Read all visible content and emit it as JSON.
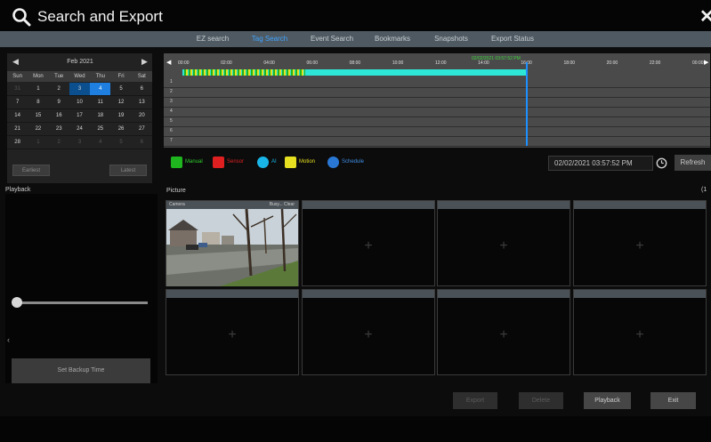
{
  "window": {
    "title": "Search and Export"
  },
  "tabs": [
    {
      "label": "EZ search"
    },
    {
      "label": "Tag Search",
      "active": true
    },
    {
      "label": "Event Search"
    },
    {
      "label": "Bookmarks"
    },
    {
      "label": "Snapshots"
    },
    {
      "label": "Export Status"
    }
  ],
  "calendar": {
    "month_label": "Feb  2021",
    "weekdays": [
      "Sun",
      "Mon",
      "Tue",
      "Wed",
      "Thu",
      "Fri",
      "Sat"
    ],
    "days": [
      {
        "d": "31",
        "muted": true
      },
      {
        "d": "1"
      },
      {
        "d": "2"
      },
      {
        "d": "3",
        "rec": true
      },
      {
        "d": "4",
        "sel": true
      },
      {
        "d": "5"
      },
      {
        "d": "6"
      },
      {
        "d": "7"
      },
      {
        "d": "8"
      },
      {
        "d": "9"
      },
      {
        "d": "10"
      },
      {
        "d": "11"
      },
      {
        "d": "12"
      },
      {
        "d": "13"
      },
      {
        "d": "14"
      },
      {
        "d": "15"
      },
      {
        "d": "16"
      },
      {
        "d": "17"
      },
      {
        "d": "18"
      },
      {
        "d": "19"
      },
      {
        "d": "20"
      },
      {
        "d": "21"
      },
      {
        "d": "22"
      },
      {
        "d": "23"
      },
      {
        "d": "24"
      },
      {
        "d": "25"
      },
      {
        "d": "26"
      },
      {
        "d": "27"
      },
      {
        "d": "28"
      },
      {
        "d": "1",
        "muted": true
      },
      {
        "d": "2",
        "muted": true
      },
      {
        "d": "3",
        "muted": true
      },
      {
        "d": "4",
        "muted": true
      },
      {
        "d": "5",
        "muted": true
      },
      {
        "d": "6",
        "muted": true
      }
    ],
    "earliest_label": "Earliest",
    "latest_label": "Latest"
  },
  "playback": {
    "label": "Playback",
    "backup_button": "Set Backup Time",
    "slider_value": 0
  },
  "timeline": {
    "ticks": [
      "00:00",
      "02:00",
      "04:00",
      "06:00",
      "08:00",
      "10:00",
      "12:00",
      "14:00",
      "16:00",
      "18:00",
      "20:00",
      "22:00",
      "00:00"
    ],
    "rows": [
      "1",
      "2",
      "3",
      "4",
      "5",
      "6",
      "7"
    ],
    "cursor_label": "02/02/2021 03:57:52 PM"
  },
  "legend": [
    {
      "label": "Manual",
      "color": "#1fb51f",
      "label_color": "#2fd02f"
    },
    {
      "label": "Sensor",
      "color": "#e02020",
      "label_color": "#e02020"
    },
    {
      "label": "AI",
      "color": "#19b6ea",
      "label_color": "#19b6ea"
    },
    {
      "label": "Motion",
      "color": "#e6e020",
      "label_color": "#e6e020"
    },
    {
      "label": "Schedule",
      "color": "#2a78d6",
      "label_color": "#3f8fe6"
    }
  ],
  "datetime": "02/02/2021 03:57:52 PM",
  "refresh_label": "Refresh",
  "pictures": {
    "label": "Picture",
    "count": "(1",
    "tile1_channel": "Camera",
    "tile1_status": "Busy... Clear"
  },
  "bottom_buttons": {
    "export": "Export",
    "delete": "Delete",
    "playback": "Playback",
    "exit": "Exit"
  },
  "colors": {
    "accent": "#3fa3ff",
    "record_bar": "#2ee6d6",
    "cursor": "#1e8fff"
  }
}
